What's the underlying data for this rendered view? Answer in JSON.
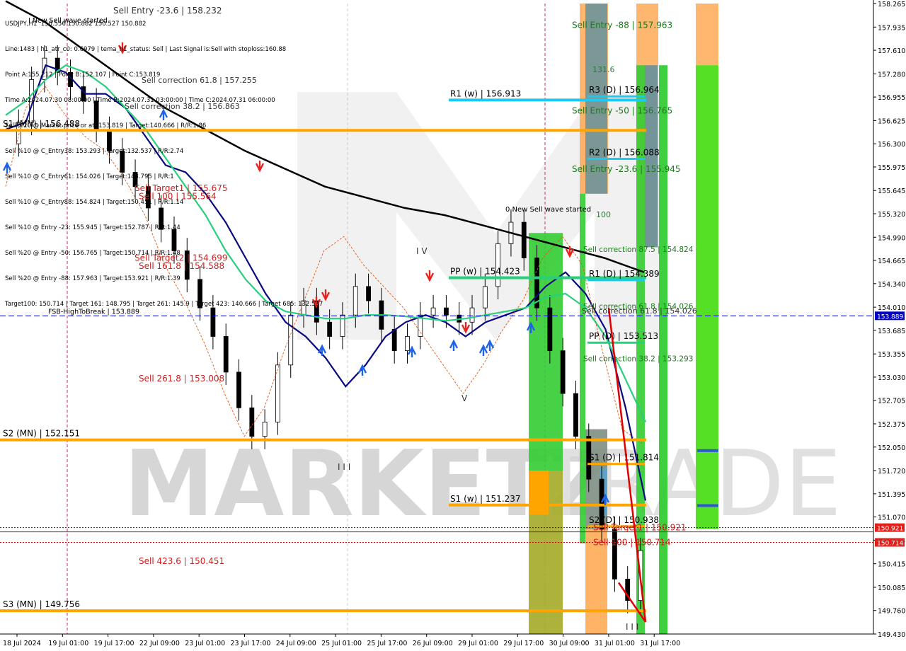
{
  "window": {
    "symbol_line": "USDJPY,H1  150.556 150.882 150.527 150.882",
    "info_lines": [
      "Line:1483 | h1_atr_c0: 0.6979 | tema_h1_status: Sell | Last Signal is:Sell with stoploss:160.88",
      "Point A:155.212 | Point B:152.107 | Point C:153.819",
      "Time A:2024.07.30 08:00:00 | Time B:2024.07.31 03:00:00 | Time C:2024.07.31 06:00:00",
      "Sell %20 @ Market price or at: 153.819 | Target:140.666 | R/R:1.86",
      "Sell %10 @ C_Entry38: 153.293 | Target:132.537 | R/R:2.74",
      "Sell %10 @ C_Entry61: 154.026 | Target:148.795 | R/R:1",
      "Sell %10 @ C_Entry88: 154.824 | Target:150.451 | R/R:1.14",
      "Sell %10 @ Entry -23: 155.945 | Target:152.787 | R/R:1.44",
      "Sell %20 @ Entry -50: 156.765 | Target:150.714 | R/R:1.48",
      "Sell %20 @ Entry -88: 157.963 | Target:153.921 | R/R:1.39",
      "Target100: 150.714 | Target 161: 148.795 | Target 261: 145.9 | Target 423: 140.666 | Target 685: 132.537"
    ]
  },
  "colors": {
    "orange": "#FFA500",
    "sky": "#1EC8F0",
    "teal": "#26D07C",
    "green": "#1DB21D",
    "light_green": "#55E025",
    "sell_red": "#CC2020",
    "navy": "#0A0A80",
    "fsb_blue": "#0000C8",
    "price_red": "#E0201A"
  },
  "chart_data": {
    "type": "candlestick",
    "symbol": "USDJPY",
    "timeframe": "H1",
    "ylim": [
      149.43,
      158.265
    ],
    "y_ticks": [
      "158.265",
      "157.935",
      "157.610",
      "157.280",
      "156.955",
      "156.625",
      "156.300",
      "155.975",
      "155.645",
      "155.320",
      "154.990",
      "154.665",
      "154.340",
      "154.010",
      "153.685",
      "153.355",
      "153.030",
      "152.705",
      "152.375",
      "152.050",
      "151.720",
      "151.395",
      "151.070",
      "150.745",
      "150.415",
      "150.085",
      "149.760",
      "149.430"
    ],
    "x_labels": [
      "18 Jul 2024",
      "19 Jul 01:00",
      "19 Jul 17:00",
      "22 Jul 09:00",
      "23 Jul 01:00",
      "23 Jul 17:00",
      "24 Jul 09:00",
      "25 Jul 01:00",
      "25 Jul 17:00",
      "26 Jul 09:00",
      "29 Jul 01:00",
      "29 Jul 17:00",
      "30 Jul 09:00",
      "31 Jul 01:00",
      "31 Jul 17:00"
    ],
    "price_tags": [
      {
        "label": "153.889",
        "value": 153.889,
        "kind": "fsb"
      },
      {
        "label": "150.921",
        "value": 150.921,
        "kind": "target"
      },
      {
        "label": "150.714",
        "value": 150.714,
        "kind": "target"
      }
    ],
    "pivot_lines": [
      {
        "label": "S1 (MN) | 156.488",
        "value": 156.488,
        "kind": "orange",
        "span": "full"
      },
      {
        "label": "S2 (MN) | 152.151",
        "value": 152.151,
        "kind": "orange",
        "span": "full"
      },
      {
        "label": "S3 (MN) | 149.756",
        "value": 149.756,
        "kind": "orange",
        "span": "full"
      },
      {
        "label": "R1 (w) | 156.913",
        "value": 156.913,
        "kind": "sky",
        "span": "week"
      },
      {
        "label": "PP (w) | 154.423",
        "value": 154.423,
        "kind": "teal",
        "span": "week"
      },
      {
        "label": "S1 (w) | 151.237",
        "value": 151.237,
        "kind": "orange",
        "span": "week"
      },
      {
        "label": "R3 (D) | 156.964",
        "value": 156.964,
        "kind": "sky",
        "span": "day"
      },
      {
        "label": "R2 (D) | 156.088",
        "value": 156.088,
        "kind": "sky",
        "span": "day"
      },
      {
        "label": "R1 (D) | 154.389",
        "value": 154.389,
        "kind": "sky",
        "span": "day"
      },
      {
        "label": "PP (D) | 153.513",
        "value": 153.513,
        "kind": "teal",
        "span": "day"
      },
      {
        "label": "S1 (D) | 151.814",
        "value": 151.814,
        "kind": "orange",
        "span": "day"
      },
      {
        "label": "S2 (D) | 150.938",
        "value": 150.938,
        "kind": "orange",
        "span": "day"
      }
    ],
    "fsb_line": {
      "label": "FSB-HighToBreak | 153.889",
      "value": 153.889
    },
    "left_labels": [
      {
        "label": "Sell Target1 | 155.675",
        "value": 155.675
      },
      {
        "label": "Sell 100 | 155.564",
        "value": 155.564
      },
      {
        "label": "Sell Target2 | 154.699",
        "value": 154.699
      },
      {
        "label": "Sell 161.8 | 154.588",
        "value": 154.588
      },
      {
        "label": "Sell  261.8 | 153.008",
        "value": 153.008
      },
      {
        "label": "Sell  423.6 | 150.451",
        "value": 150.451
      }
    ],
    "right_labels": [
      {
        "label": "Sell Entry -88 | 157.963",
        "value": 157.963,
        "color": "green"
      },
      {
        "label": "Sell Entry -50 | 156.765",
        "value": 156.765,
        "color": "green"
      },
      {
        "label": "Sell Entry -23.6 | 155.945",
        "value": 155.945,
        "color": "green"
      },
      {
        "label": "Sell correction 87.5 | 154.824",
        "value": 154.824,
        "color": "green"
      },
      {
        "label": "Sell correction 61.8 | 154.026",
        "value": 154.026,
        "color": "green"
      },
      {
        "label": "Sell correction 38.2 | 153.293",
        "value": 153.293,
        "color": "green"
      },
      {
        "label": "Sell Target1 | 150.921",
        "value": 150.921,
        "color": "red"
      },
      {
        "label": "Sell 100 | 150.714",
        "value": 150.714,
        "color": "red"
      }
    ],
    "overlay_text": [
      "0 New Sell wave started",
      "I New Sell wave started",
      "Sell Entry -23.6 | 158.232",
      "Sell correction 38.2 | 156.863",
      "Sell correction 61.8 | 157.255",
      "131.6",
      "100",
      "Sell correction 61.8 | 154.026",
      "I V",
      "V",
      "I I I"
    ],
    "watermark": "MARKETZ TRADE",
    "series": [
      {
        "name": "TEMA fast",
        "color": "#0A0A80",
        "kind": "line",
        "values": [
          156.5,
          156.6,
          157.4,
          157.3,
          157.0,
          157.0,
          156.8,
          156.4,
          156.0,
          155.9,
          155.6,
          155.2,
          154.7,
          154.2,
          153.8,
          153.6,
          153.3,
          152.9,
          153.2,
          153.6,
          153.8,
          153.9,
          153.8,
          153.6,
          153.8,
          153.9,
          154.0,
          154.3,
          154.5,
          154.2,
          153.7,
          152.6,
          151.3
        ]
      },
      {
        "name": "Slow MA",
        "color": "#26D07C",
        "kind": "line",
        "values": [
          156.7,
          156.9,
          157.2,
          157.4,
          157.3,
          157.1,
          156.8,
          156.5,
          156.1,
          155.7,
          155.3,
          154.8,
          154.4,
          154.1,
          153.95,
          153.9,
          153.85,
          153.85,
          153.9,
          153.9,
          153.88,
          153.85,
          153.82,
          153.85,
          153.9,
          153.95,
          154.0,
          154.15,
          154.2,
          154.0,
          153.6,
          153.0,
          152.4
        ]
      },
      {
        "name": "Long MA",
        "color": "#000000",
        "kind": "line",
        "values": [
          158.3,
          158.0,
          157.6,
          157.2,
          156.8,
          156.5,
          156.2,
          155.95,
          155.7,
          155.55,
          155.4,
          155.3,
          155.15,
          155.0,
          154.85,
          154.7,
          154.5
        ]
      }
    ]
  }
}
